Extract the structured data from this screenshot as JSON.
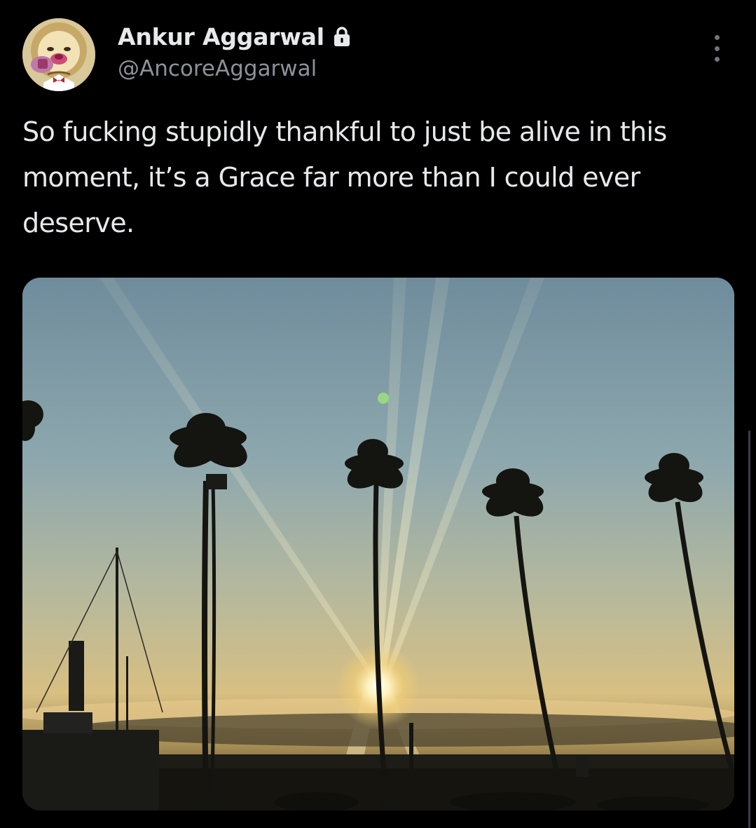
{
  "user": {
    "display_name": "Ankur Aggarwal",
    "handle": "@AncoreAggarwal",
    "avatar_icon": "cartoon-lion-avatar",
    "protected_icon": "lock-icon"
  },
  "tweet": {
    "text": "So fucking stupidly thankful to just be alive in this moment, it’s a Grace far more than I could ever deserve."
  },
  "media": {
    "icon": "sunset-palm-trees-photo"
  },
  "menu": {
    "icon": "more-options-icon"
  },
  "colors": {
    "background": "#000000",
    "text": "#e7e9ea",
    "secondary_text": "#8b9299"
  }
}
